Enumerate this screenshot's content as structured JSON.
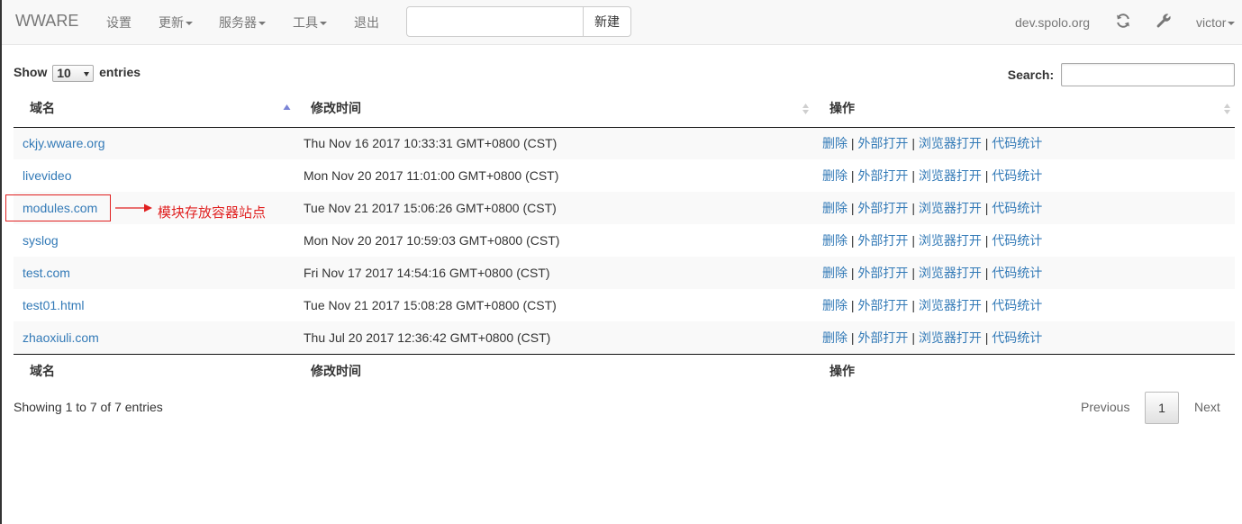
{
  "navbar": {
    "brand": "WWARE",
    "items": [
      {
        "label": "设置",
        "dropdown": false
      },
      {
        "label": "更新",
        "dropdown": true
      },
      {
        "label": "服务器",
        "dropdown": true
      },
      {
        "label": "工具",
        "dropdown": true
      },
      {
        "label": "退出",
        "dropdown": false
      }
    ],
    "search_value": "",
    "new_button": "新建",
    "host": "dev.spolo.org",
    "user": "victor"
  },
  "controls": {
    "show_label": "Show",
    "page_length": "10",
    "entries_label": "entries",
    "search_label": "Search:"
  },
  "table": {
    "columns": [
      "域名",
      "修改时间",
      "操作"
    ],
    "sorted_column": 0,
    "sort_direction": "asc",
    "rows": [
      {
        "domain": "ckjy.wware.org",
        "modified": "Thu Nov 16 2017 10:33:31 GMT+0800 (CST)"
      },
      {
        "domain": "livevideo",
        "modified": "Mon Nov 20 2017 11:01:00 GMT+0800 (CST)"
      },
      {
        "domain": "modules.com",
        "modified": "Tue Nov 21 2017 15:06:26 GMT+0800 (CST)"
      },
      {
        "domain": "syslog",
        "modified": "Mon Nov 20 2017 10:59:03 GMT+0800 (CST)"
      },
      {
        "domain": "test.com",
        "modified": "Fri Nov 17 2017 14:54:16 GMT+0800 (CST)"
      },
      {
        "domain": "test01.html",
        "modified": "Tue Nov 21 2017 15:08:28 GMT+0800 (CST)"
      },
      {
        "domain": "zhaoxiuli.com",
        "modified": "Thu Jul 20 2017 12:36:42 GMT+0800 (CST)"
      }
    ],
    "actions": [
      "删除",
      "外部打开",
      "浏览器打开",
      "代码统计"
    ],
    "action_separator": "|"
  },
  "annotation": {
    "text": "模块存放容器站点",
    "color": "#e02020"
  },
  "footer": {
    "info": "Showing 1 to 7 of 7 entries",
    "previous": "Previous",
    "current_page": "1",
    "next": "Next"
  },
  "colors": {
    "link": "#337ab7",
    "navbar_bg": "#f8f8f8",
    "sort_active": "#7a84d6"
  }
}
